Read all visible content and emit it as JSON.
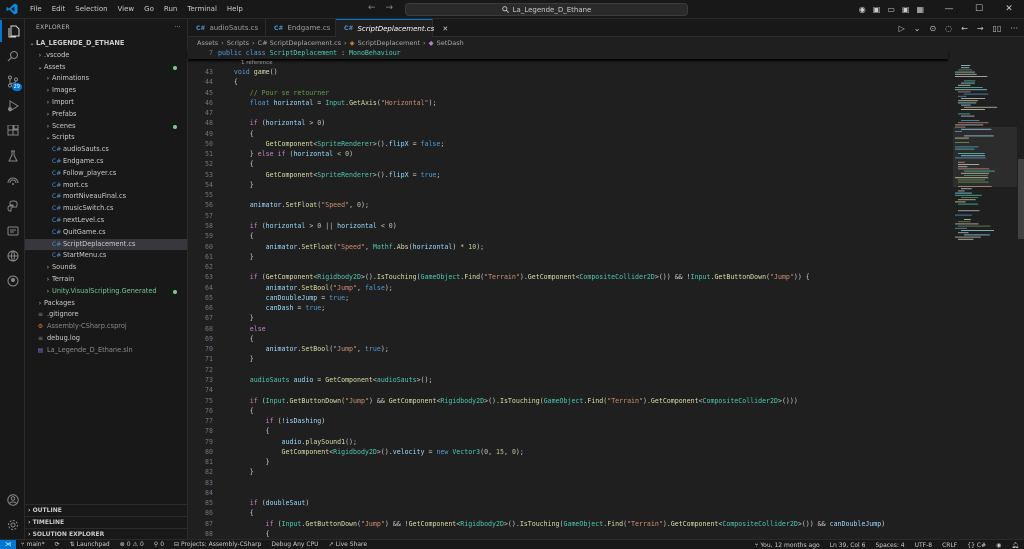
{
  "titlebar": {
    "menus": [
      "File",
      "Edit",
      "Selection",
      "View",
      "Go",
      "Run",
      "Terminal",
      "Help"
    ],
    "search_text": "La_Legende_D_Ethane"
  },
  "colors": {
    "accent": "#0078d4",
    "bg": "#1f1f1f",
    "sidebar": "#181818",
    "git_added": "#73c991"
  },
  "activity": {
    "badge": "29"
  },
  "sidebar": {
    "title": "EXPLORER",
    "more": "···",
    "tree": [
      {
        "label": "LA_LEGENDE_D_ETHANE",
        "depth": 0,
        "chev": "⌄",
        "bold": true
      },
      {
        "label": ".vscode",
        "depth": 1,
        "chev": "›"
      },
      {
        "label": "Assets",
        "depth": 1,
        "chev": "⌄",
        "dot": true
      },
      {
        "label": "Animations",
        "depth": 2,
        "chev": "›"
      },
      {
        "label": "Images",
        "depth": 2,
        "chev": "›"
      },
      {
        "label": "Import",
        "depth": 2,
        "chev": "›"
      },
      {
        "label": "Prefabs",
        "depth": 2,
        "chev": "›"
      },
      {
        "label": "Scenes",
        "depth": 2,
        "chev": "›",
        "dot": true
      },
      {
        "label": "Scripts",
        "depth": 2,
        "chev": "⌄"
      },
      {
        "label": "audioSauts.cs",
        "depth": 3,
        "icon": "C#"
      },
      {
        "label": "Endgame.cs",
        "depth": 3,
        "icon": "C#"
      },
      {
        "label": "Follow_player.cs",
        "depth": 3,
        "icon": "C#"
      },
      {
        "label": "mort.cs",
        "depth": 3,
        "icon": "C#"
      },
      {
        "label": "mortNiveauFinal.cs",
        "depth": 3,
        "icon": "C#"
      },
      {
        "label": "musicSwitch.cs",
        "depth": 3,
        "icon": "C#"
      },
      {
        "label": "nextLevel.cs",
        "depth": 3,
        "icon": "C#"
      },
      {
        "label": "QuitGame.cs",
        "depth": 3,
        "icon": "C#"
      },
      {
        "label": "ScriptDeplacement.cs",
        "depth": 3,
        "icon": "C#",
        "selected": true
      },
      {
        "label": "StartMenu.cs",
        "depth": 3,
        "icon": "C#"
      },
      {
        "label": "Sounds",
        "depth": 2,
        "chev": "›"
      },
      {
        "label": "Terrain",
        "depth": 2,
        "chev": "›"
      },
      {
        "label": "Unity.VisualScripting.Generated",
        "depth": 2,
        "chev": "›",
        "green": true,
        "dot": true
      },
      {
        "label": "Packages",
        "depth": 1,
        "chev": "›"
      },
      {
        "label": ".gitignore",
        "depth": 1,
        "icon": "≡"
      },
      {
        "label": "Assembly-CSharp.csproj",
        "depth": 1,
        "icon": "⚙",
        "dim": true
      },
      {
        "label": "debug.log",
        "depth": 1,
        "icon": "≡"
      },
      {
        "label": "La_Legende_D_Ethane.sln",
        "depth": 1,
        "icon": "▤",
        "dim": true
      }
    ],
    "bottom": [
      "OUTLINE",
      "TIMELINE",
      "SOLUTION EXPLORER"
    ]
  },
  "tabs": [
    {
      "label": "audioSauts.cs",
      "active": false
    },
    {
      "label": "Endgame.cs",
      "active": false
    },
    {
      "label": "ScriptDeplacement.cs",
      "active": true
    }
  ],
  "breadcrumb": [
    "Assets",
    "Scripts",
    "C# ScriptDeplacement.cs",
    "ScriptDeplacement",
    "SetDash"
  ],
  "sticky": {
    "line": "7",
    "text": "public class ScriptDeplacement : MonoBehaviour"
  },
  "codelens": "1 reference",
  "code": [
    {
      "n": "43",
      "h": "    <span class='kw'>void</span> <span class='fn'>game</span>()"
    },
    {
      "n": "44",
      "h": "    {"
    },
    {
      "n": "45",
      "h": "        <span class='cm'>// Pour se retourner</span>"
    },
    {
      "n": "46",
      "h": "        <span class='kw'>float</span> <span class='vr'>horizontal</span> = <span class='ty'>Input</span>.<span class='fn'>GetAxis</span>(<span class='st'>\"Horizontal\"</span>);"
    },
    {
      "n": "47",
      "h": ""
    },
    {
      "n": "48",
      "h": "        <span class='ctl'>if</span> (<span class='vr'>horizontal</span> &gt; <span class='nm'>0</span>)"
    },
    {
      "n": "49",
      "h": "        {"
    },
    {
      "n": "50",
      "h": "            <span class='fn'>GetComponent</span>&lt;<span class='ty'>SpriteRenderer</span>&gt;().<span class='vr'>flipX</span> = <span class='kw'>false</span>;"
    },
    {
      "n": "51",
      "h": "        } <span class='ctl'>else if</span> (<span class='vr'>horizontal</span> &lt; <span class='nm'>0</span>)"
    },
    {
      "n": "52",
      "h": "        {"
    },
    {
      "n": "53",
      "h": "            <span class='fn'>GetComponent</span>&lt;<span class='ty'>SpriteRenderer</span>&gt;().<span class='vr'>flipX</span> = <span class='kw'>true</span>;"
    },
    {
      "n": "54",
      "h": "        }"
    },
    {
      "n": "55",
      "h": ""
    },
    {
      "n": "56",
      "h": "        <span class='vr'>animator</span>.<span class='fn'>SetFloat</span>(<span class='st'>\"Speed\"</span>, <span class='nm'>0</span>);"
    },
    {
      "n": "57",
      "h": ""
    },
    {
      "n": "58",
      "h": "        <span class='ctl'>if</span> (<span class='vr'>horizontal</span> &gt; <span class='nm'>0</span> || <span class='vr'>horizontal</span> &lt; <span class='nm'>0</span>)"
    },
    {
      "n": "59",
      "h": "        {"
    },
    {
      "n": "60",
      "h": "            <span class='vr'>animator</span>.<span class='fn'>SetFloat</span>(<span class='st'>\"Speed\"</span>, <span class='ty'>Mathf</span>.<span class='fn'>Abs</span>(<span class='vr'>horizontal</span>) * <span class='nm'>10</span>);"
    },
    {
      "n": "61",
      "h": "        }"
    },
    {
      "n": "62",
      "h": ""
    },
    {
      "n": "63",
      "h": "        <span class='ctl'>if</span> (<span class='fn'>GetComponent</span>&lt;<span class='ty'>Rigidbody2D</span>&gt;().<span class='fn'>IsTouching</span>(<span class='ty'>GameObject</span>.<span class='fn'>Find</span>(<span class='st'>\"Terrain\"</span>).<span class='fn'>GetComponent</span>&lt;<span class='ty'>CompositeCollider2D</span>&gt;()) &amp;&amp; !<span class='ty'>Input</span>.<span class='fn'>GetButtonDown</span>(<span class='st'>\"Jump\"</span>)) {"
    },
    {
      "n": "64",
      "h": "            <span class='vr'>animator</span>.<span class='fn'>SetBool</span>(<span class='st'>\"Jump\"</span>, <span class='kw'>false</span>);"
    },
    {
      "n": "65",
      "h": "            <span class='vr'>canDoubleJump</span> = <span class='kw'>true</span>;"
    },
    {
      "n": "66",
      "h": "            <span class='vr'>canDash</span> = <span class='kw'>true</span>;"
    },
    {
      "n": "67",
      "h": "        }"
    },
    {
      "n": "68",
      "h": "        <span class='ctl'>else</span>"
    },
    {
      "n": "69",
      "h": "        {"
    },
    {
      "n": "70",
      "h": "            <span class='vr'>animator</span>.<span class='fn'>SetBool</span>(<span class='st'>\"Jump\"</span>, <span class='kw'>true</span>);"
    },
    {
      "n": "71",
      "h": "        }"
    },
    {
      "n": "72",
      "h": ""
    },
    {
      "n": "73",
      "h": "        <span class='ty'>audioSauts</span> <span class='vr'>audio</span> = <span class='fn'>GetComponent</span>&lt;<span class='ty'>audioSauts</span>&gt;();"
    },
    {
      "n": "74",
      "h": ""
    },
    {
      "n": "75",
      "h": "        <span class='ctl'>if</span> (<span class='ty'>Input</span>.<span class='fn'>GetButtonDown</span>(<span class='st'>\"Jump\"</span>) &amp;&amp; <span class='fn'>GetComponent</span>&lt;<span class='ty'>Rigidbody2D</span>&gt;().<span class='fn'>IsTouching</span>(<span class='ty'>GameObject</span>.<span class='fn'>Find</span>(<span class='st'>\"Terrain\"</span>).<span class='fn'>GetComponent</span>&lt;<span class='ty'>CompositeCollider2D</span>&gt;()))"
    },
    {
      "n": "76",
      "h": "        {"
    },
    {
      "n": "77",
      "h": "            <span class='ctl'>if</span> (!<span class='vr'>isDashing</span>)"
    },
    {
      "n": "78",
      "h": "            {"
    },
    {
      "n": "79",
      "h": "                <span class='vr'>audio</span>.<span class='fn'>playSound1</span>();"
    },
    {
      "n": "80",
      "h": "                <span class='fn'>GetComponent</span>&lt;<span class='ty'>Rigidbody2D</span>&gt;().<span class='vr'>velocity</span> = <span class='kw'>new</span> <span class='ty'>Vector3</span>(<span class='nm'>0</span>, <span class='nm'>15</span>, <span class='nm'>0</span>);"
    },
    {
      "n": "81",
      "h": "            }"
    },
    {
      "n": "82",
      "h": "        }"
    },
    {
      "n": "83",
      "h": ""
    },
    {
      "n": "84",
      "h": ""
    },
    {
      "n": "85",
      "h": "        <span class='ctl'>if</span> (<span class='vr'>doubleSaut</span>)"
    },
    {
      "n": "86",
      "h": "        {"
    },
    {
      "n": "87",
      "h": "            <span class='ctl'>if</span> (<span class='ty'>Input</span>.<span class='fn'>GetButtonDown</span>(<span class='st'>\"Jump\"</span>) &amp;&amp; !<span class='fn'>GetComponent</span>&lt;<span class='ty'>Rigidbody2D</span>&gt;().<span class='fn'>IsTouching</span>(<span class='ty'>GameObject</span>.<span class='fn'>Find</span>(<span class='st'>\"Terrain\"</span>).<span class='fn'>GetComponent</span>&lt;<span class='ty'>CompositeCollider2D</span>&gt;()) &amp;&amp; <span class='vr'>canDoubleJump</span>)"
    },
    {
      "n": "88",
      "h": "            {"
    }
  ],
  "statusbar": {
    "branch": "main*",
    "launchpad": "Launchpad",
    "errors": "0",
    "warnings": "0",
    "ports": "0",
    "projects": "Projects: Assembly-CSharp",
    "debug": "Debug Any CPU",
    "liveshare": "Live Share",
    "blame": "You, 12 months ago",
    "position": "Ln 39, Col 6",
    "spaces": "Spaces: 4",
    "encoding": "UTF-8",
    "eol": "CRLF",
    "language": "C#"
  }
}
